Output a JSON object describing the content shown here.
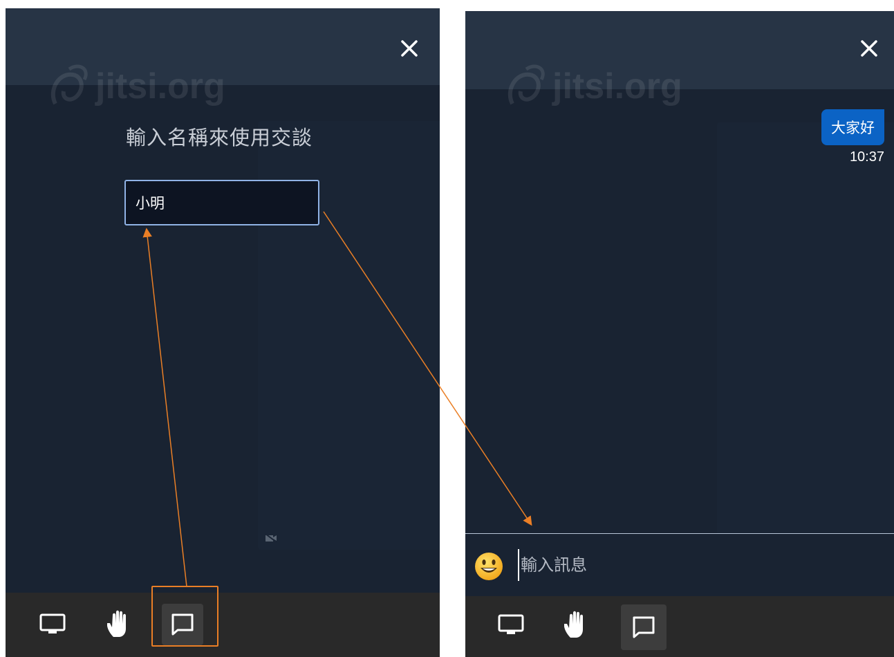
{
  "colors": {
    "header": "#273445",
    "background": "#192332",
    "toolbar": "#292929",
    "accent": "#0b63c5",
    "annotation": "#ea7f26",
    "input_border": "#90b3e6"
  },
  "left_panel": {
    "header": {
      "close_icon": "close-icon"
    },
    "watermark": "jitsi.org",
    "prompt_title": "輸入名稱來使用交談",
    "name_input": {
      "value": "小明"
    },
    "toolbar": {
      "items": [
        {
          "icon": "screen-share-icon",
          "active": false
        },
        {
          "icon": "raise-hand-icon",
          "active": false
        },
        {
          "icon": "chat-icon",
          "active": true
        }
      ]
    }
  },
  "right_panel": {
    "header": {
      "close_icon": "close-icon"
    },
    "watermark": "jitsi.org",
    "message": {
      "text": "大家好",
      "time": "10:37"
    },
    "chat_input": {
      "placeholder": "輸入訊息",
      "emoji_icon": "smiley-emoji-icon"
    },
    "toolbar": {
      "items": [
        {
          "icon": "screen-share-icon",
          "active": false
        },
        {
          "icon": "raise-hand-icon",
          "active": false
        },
        {
          "icon": "chat-icon",
          "active": true
        }
      ]
    }
  }
}
